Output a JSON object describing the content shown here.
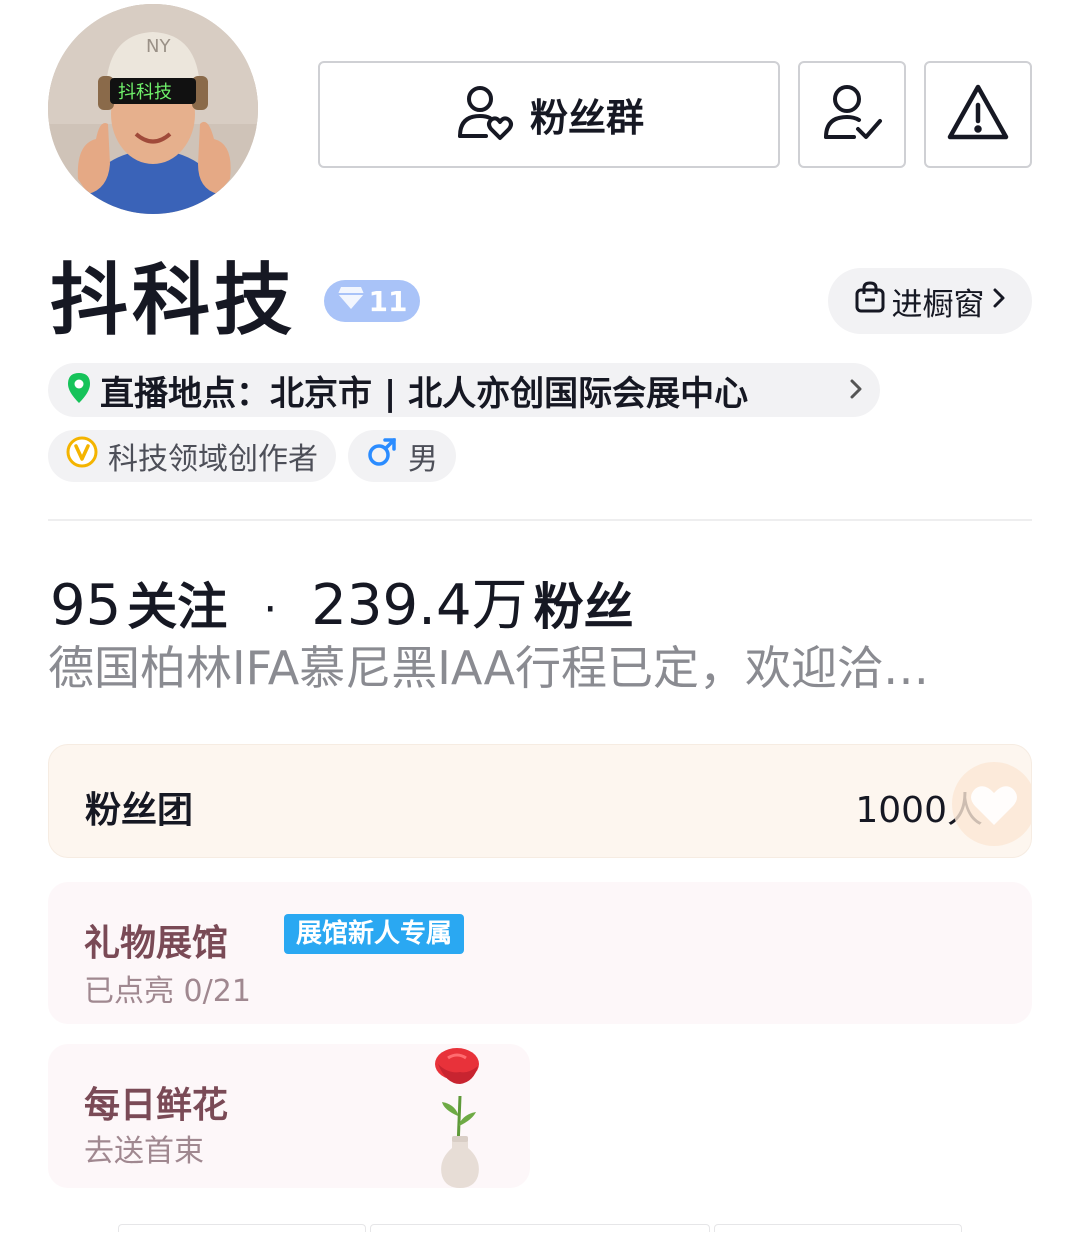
{
  "header": {
    "fans_group_label": "粉丝群",
    "avatar_logo_text": "抖科技"
  },
  "profile": {
    "name": "抖科技",
    "level": "11",
    "shop_label": "进橱窗",
    "location": "直播地点：北京市 | 北人亦创国际会展中心",
    "creator_tag": "科技领域创作者",
    "gender": "男"
  },
  "stats": {
    "following_count": "95",
    "following_label": "关注",
    "separator": "·",
    "fans_count": "239.4万",
    "fans_label": "粉丝"
  },
  "bio": "德国柏林IFA慕尼黑IAA行程已定，欢迎洽…",
  "fan_club": {
    "title": "粉丝团",
    "count": "1000人"
  },
  "gift_hall": {
    "title": "礼物展馆",
    "badge": "展馆新人专属",
    "progress_text": "已点亮 0/21"
  },
  "daily_flower": {
    "title": "每日鲜花",
    "action": "去送首束"
  },
  "colors": {
    "accent_blue": "#2aa8f2",
    "level_badge": "#a9c3f8",
    "location_pin": "#16c35a",
    "creator_badge": "#f4b400",
    "gender_male": "#2b8cff"
  }
}
